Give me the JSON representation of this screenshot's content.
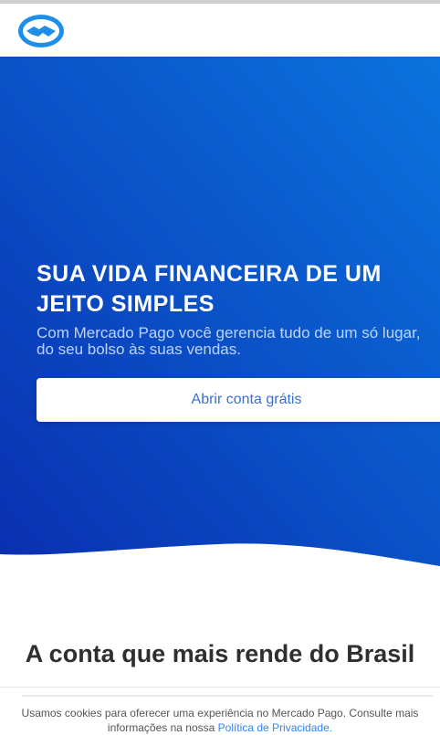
{
  "header": {
    "logo_icon": "mercado-pago-handshake-logo"
  },
  "hero": {
    "title": "SUA VIDA FINANCEIRA DE UM JEITO SIMPLES",
    "subtitle": "Com Mercado Pago você gerencia tudo de um só lugar, do seu bolso às suas vendas.",
    "cta_label": "Abrir conta grátis",
    "colors": {
      "gradient_start": "#0b74de",
      "gradient_end": "#0a2fb0"
    }
  },
  "section": {
    "title": "A conta que mais rende do Brasil"
  },
  "cookie_banner": {
    "text": "Usamos cookies para oferecer uma experiência no Mercado Pago. Consulte mais informações na nossa",
    "link_text": "Política de Privacidade."
  }
}
